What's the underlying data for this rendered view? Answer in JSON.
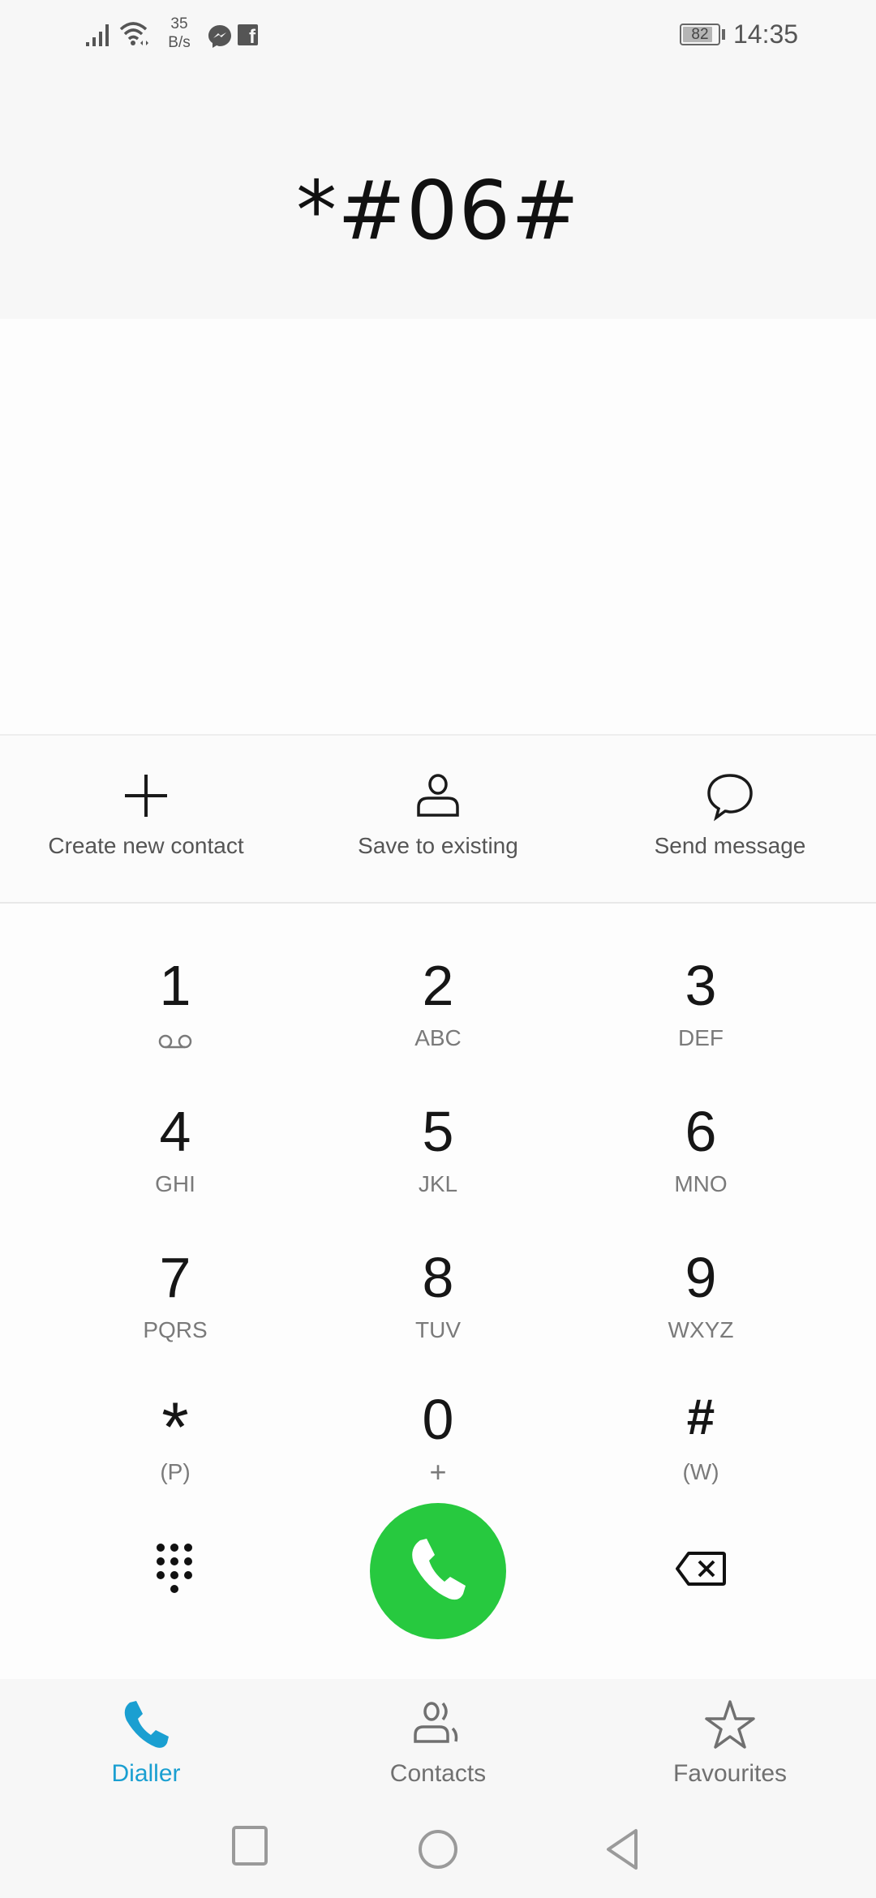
{
  "status_bar": {
    "network_speed_value": "35",
    "network_speed_unit": "B/s",
    "battery_level": "82",
    "time": "14:35",
    "icons": [
      "signal-icon",
      "wifi-icon",
      "messenger-icon",
      "facebook-icon",
      "battery-icon"
    ]
  },
  "dialer": {
    "input_value": "*#06#"
  },
  "actions": [
    {
      "label": "Create new contact",
      "icon": "plus-icon"
    },
    {
      "label": "Save to existing",
      "icon": "person-icon"
    },
    {
      "label": "Send message",
      "icon": "message-bubble-icon"
    }
  ],
  "keypad": {
    "keys": [
      {
        "digit": "1",
        "letters": ""
      },
      {
        "digit": "2",
        "letters": "ABC"
      },
      {
        "digit": "3",
        "letters": "DEF"
      },
      {
        "digit": "4",
        "letters": "GHI"
      },
      {
        "digit": "5",
        "letters": "JKL"
      },
      {
        "digit": "6",
        "letters": "MNO"
      },
      {
        "digit": "7",
        "letters": "PQRS"
      },
      {
        "digit": "8",
        "letters": "TUV"
      },
      {
        "digit": "9",
        "letters": "WXYZ"
      },
      {
        "digit": "*",
        "letters": "(P)"
      },
      {
        "digit": "0",
        "letters": "+"
      },
      {
        "digit": "#",
        "letters": "(W)"
      }
    ],
    "voicemail_icon": "voicemail-icon"
  },
  "controls": {
    "call_color": "#27c93f"
  },
  "tabs": [
    {
      "label": "Dialler",
      "active": true
    },
    {
      "label": "Contacts",
      "active": false
    },
    {
      "label": "Favourites",
      "active": false
    }
  ],
  "colors": {
    "accent": "#1a9fd1",
    "call_green": "#27c93f"
  }
}
